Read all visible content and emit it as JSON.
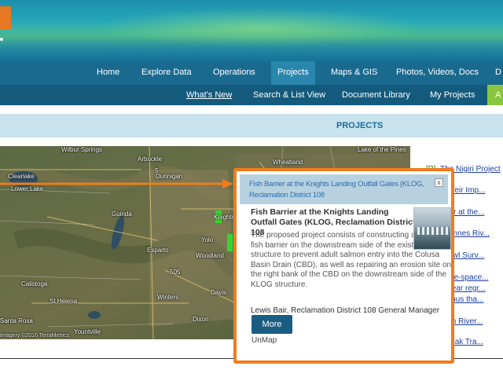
{
  "nav": {
    "items": [
      {
        "label": "Home",
        "active": false
      },
      {
        "label": "Explore Data",
        "active": false
      },
      {
        "label": "Operations",
        "active": false
      },
      {
        "label": "Projects",
        "active": true
      },
      {
        "label": "Maps & GIS",
        "active": false
      },
      {
        "label": "Photos, Videos, Docs",
        "active": false
      },
      {
        "label": "D",
        "active": false
      }
    ]
  },
  "subnav": {
    "items": [
      {
        "label": "What's New"
      },
      {
        "label": "Search & List View"
      },
      {
        "label": "Document Library"
      },
      {
        "label": "My Projects"
      },
      {
        "label": "A"
      }
    ]
  },
  "section": {
    "title": "PROJECTS"
  },
  "map": {
    "places": [
      "Wilbur Springs",
      "Arbuckle",
      "Lake of the Pines",
      "Clearlake",
      "Wheatland",
      "Lower Lake",
      "Dunnigan",
      "Guinda",
      "Knights Landing",
      "Yolo",
      "Esparto",
      "Woodland",
      "Calistoga",
      "Winters",
      "Davis",
      "St Helena",
      "Dixon",
      "Santa Rosa",
      "Yountville"
    ],
    "road_labels": [
      "5",
      "505"
    ],
    "copyright": "Imagery ©2016 TerraMetrics"
  },
  "popup": {
    "header_title": "Fish Barrier at the Knights Landing Outfall Gates (KLOG, Reclamation District 108",
    "close_glyph": "x",
    "title": "Fish Barrier at the Knights Landing Outfall Gates (KLOG, Reclamation District 108",
    "description": "The proposed project consists of constructing a positive fish barrier on the downstream side of the existing KLOG structure to prevent adult salmon entry into the Colusa Basin Drain (CBD), as well as repairing an erosion site on the right bank of the CBD on the downstream side of the KLOG structure.",
    "owner": "Lewis Bair, Reclamation District 108 General Manager",
    "more_label": "More",
    "unmap_label": "UnMap"
  },
  "project_list": [
    {
      "prefix": "[P]",
      "text": "The Nigiri Project"
    },
    {
      "prefix": "",
      "text": "...ace Weir Imp..."
    },
    {
      "prefix": "",
      "text": "...Barrier at the..."
    },
    {
      "prefix": "",
      "text": "...Cosumnes Riv..."
    },
    {
      "prefix": "",
      "text": "...M Trawl Surv..."
    },
    {
      "prefix": "",
      "text": "...of state-space..."
    },
    {
      "prefix": "",
      "text": "...og-linear regr..."
    },
    {
      "prefix": "",
      "text": "...pirinchus tha..."
    },
    {
      "prefix": "",
      "text": "...oaquin River..."
    },
    {
      "prefix": "",
      "text": "...g Kodiak Tra..."
    }
  ],
  "colors": {
    "callout": "#f07c1e",
    "nav": "#1a6a90",
    "subnav": "#135a7c",
    "accent_green": "#8cc63f",
    "link": "#1a3fa0"
  }
}
